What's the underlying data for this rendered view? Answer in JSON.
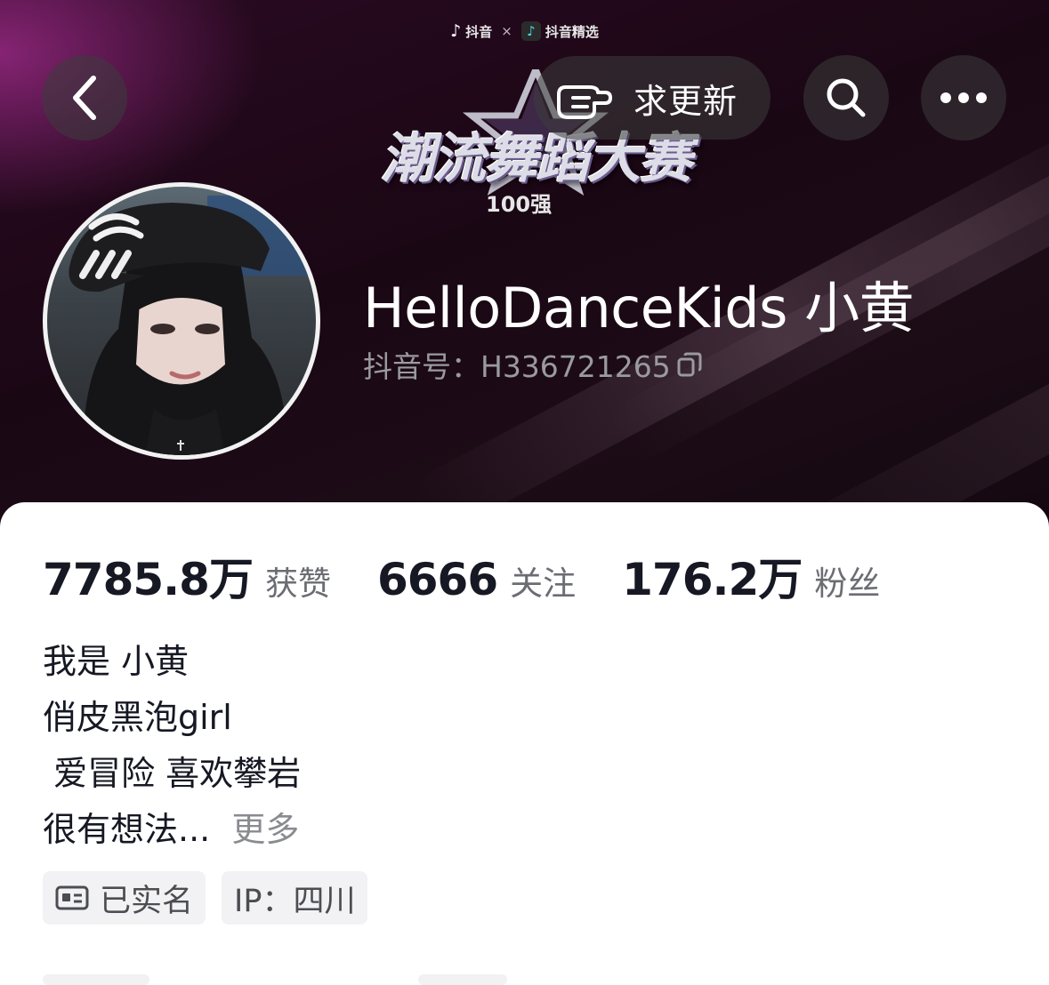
{
  "brand": {
    "left_name": "抖音",
    "separator": "×",
    "right_name": "抖音精选"
  },
  "header": {
    "request_update_label": "求更新"
  },
  "badge": {
    "title": "潮流舞蹈大赛",
    "subtitle": "100强"
  },
  "profile": {
    "name": "HelloDanceKids  小黄",
    "douyin_id": "抖音号：H336721265"
  },
  "stats": {
    "likes_value": "7785.8万",
    "likes_label": "获赞",
    "following_value": "6666",
    "following_label": "关注",
    "followers_value": "176.2万",
    "followers_label": "粉丝"
  },
  "bio": {
    "line1": "我是 小黄",
    "line2": "俏皮黑泡girl",
    "line3": " 爱冒险 喜欢攀岩",
    "line4": "很有想法...",
    "more": "更多"
  },
  "tags": {
    "verified": "已实名",
    "ip": "IP：四川"
  },
  "icons": {
    "back": "chevron-left-icon",
    "search": "search-icon",
    "more": "more-dots-icon",
    "pointing": "pointing-hand-icon",
    "copy": "copy-icon",
    "id_card": "id-card-icon"
  }
}
